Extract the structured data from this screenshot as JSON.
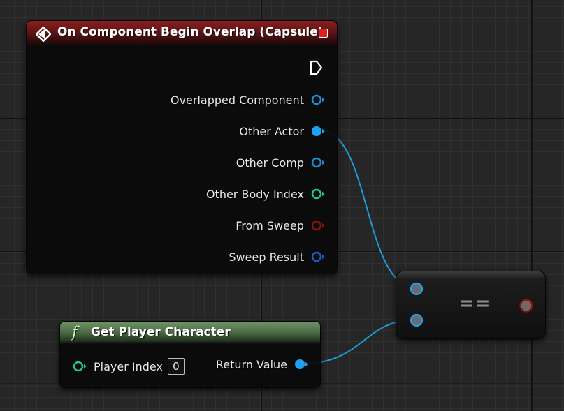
{
  "event_node": {
    "title": "On Component Begin Overlap (Capsule)",
    "pins": [
      {
        "label": "Overlapped Component",
        "color": "#1f8cd6",
        "connected": false
      },
      {
        "label": "Other Actor",
        "color": "#20a0f0",
        "connected": true
      },
      {
        "label": "Other Comp",
        "color": "#1f8cd6",
        "connected": false
      },
      {
        "label": "Other Body Index",
        "color": "#1fc49a",
        "connected": false
      },
      {
        "label": "From Sweep",
        "color": "#8e1010",
        "connected": false
      },
      {
        "label": "Sweep Result",
        "color": "#1a5ec8",
        "connected": false
      }
    ]
  },
  "function_node": {
    "icon": "f",
    "title": "Get Player Character",
    "input_label": "Player Index",
    "input_value": "0",
    "input_color": "#1fc49a",
    "output_label": "Return Value",
    "output_color": "#20a0f0"
  },
  "equal_node": {
    "label": "==",
    "input_color": "#20a0f0",
    "output_color": "#8e1010"
  },
  "colors": {
    "wire": "#1e9ad6",
    "event_header": "#8a1e1e",
    "function_header": "#6f9468",
    "background": "#262626"
  }
}
